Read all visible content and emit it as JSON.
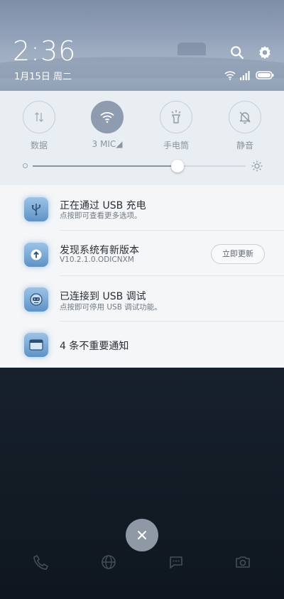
{
  "status": {
    "time": "2:36",
    "date": "1月15日 周二"
  },
  "quick_settings": {
    "toggles": [
      {
        "label": "数据",
        "icon": "data-arrows-icon",
        "active": false
      },
      {
        "label": "3   MIC◢",
        "icon": "wifi-icon",
        "active": true
      },
      {
        "label": "手电筒",
        "icon": "flashlight-icon",
        "active": false
      },
      {
        "label": "静音",
        "icon": "bell-mute-icon",
        "active": false
      }
    ],
    "brightness": 0.68
  },
  "notifications": [
    {
      "title": "正在通过 USB 充电",
      "subtitle": "点按即可查看更多选项。",
      "icon": "usb-icon"
    },
    {
      "title": "发现系统有新版本",
      "subtitle": "V10.2.1.0.ODICNXM",
      "icon": "update-arrow-icon",
      "action": "立即更新"
    },
    {
      "title": "已连接到 USB 调试",
      "subtitle": "点按即可停用 USB 调试功能。",
      "icon": "android-debug-icon"
    },
    {
      "title": "4 条不重要通知",
      "subtitle": "",
      "icon": "folded-notification-icon"
    }
  ],
  "colors": {
    "header_bg": "#95a4bb",
    "panel_bg": "#e9eef2",
    "toggle_active": "#8f9cb0",
    "notif_icon": "#5e93c6"
  }
}
